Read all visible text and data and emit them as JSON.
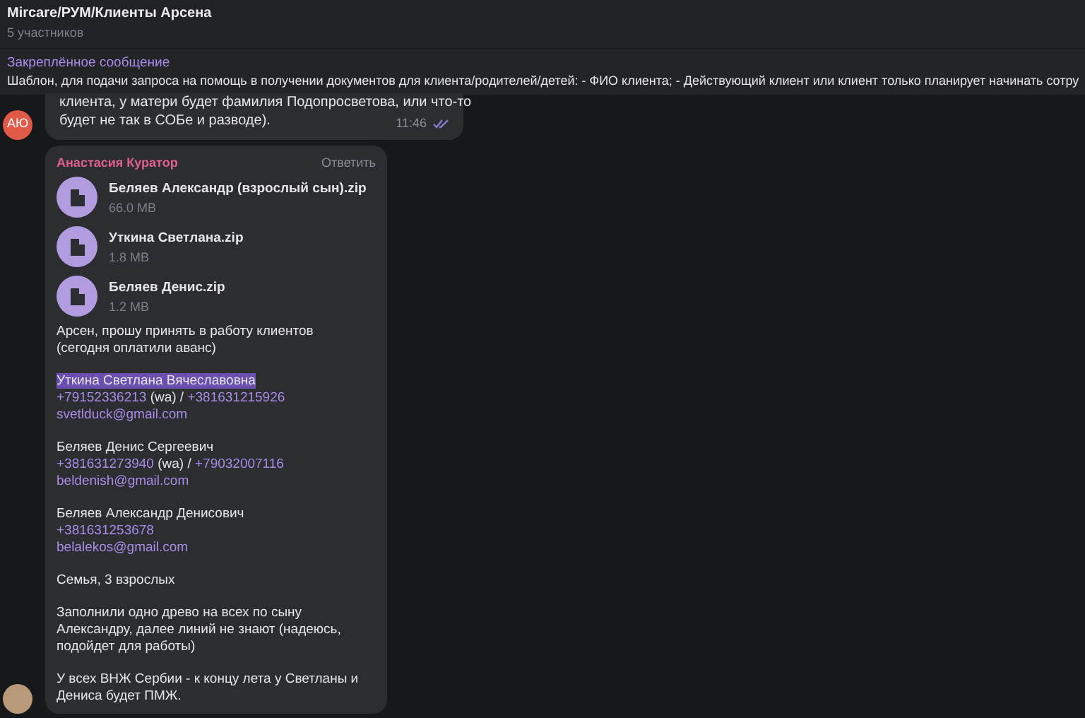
{
  "header": {
    "title": "Mircare/РУМ/Клиенты Арсена",
    "subtitle": "5 участников"
  },
  "pinned": {
    "label": "Закреплённое сообщение",
    "text": "Шаблон, для подачи запроса на помощь в получении документов для клиента/родителей/детей: - ФИО клиента; - Действующий клиент или клиент только планирует начинать сотру"
  },
  "messages": [
    {
      "kind": "text",
      "avatar": {
        "kind": "initials",
        "initials": "АЮ",
        "color": "#e05a47"
      },
      "lines": [
        "клиента, у матери будет фамилия Подопросветова, или что-то",
        "будет не так в СОБе и разводе)."
      ],
      "time": "11:46",
      "read": true
    },
    {
      "kind": "files",
      "avatar": {
        "kind": "photo"
      },
      "sender": "Анастасия Куратор",
      "reply": "Ответить",
      "files": [
        {
          "name": "Беляев Александр (взрослый сын).zip",
          "size": "66.0 MB"
        },
        {
          "name": "Уткина Светлана.zip",
          "size": "1.8 MB"
        },
        {
          "name": "Беляев Денис.zip",
          "size": "1.2 MB"
        }
      ],
      "intro": [
        "Арсен, прошу принять в работу клиентов",
        "(сегодня оплатили аванс)"
      ],
      "contacts": [
        {
          "name": "Уткина Светлана Вячеславовна",
          "selected": true,
          "phones": [
            {
              "number": "+79152336213",
              "note": "(wa) /"
            },
            {
              "number": "+381631215926"
            }
          ],
          "email": "svetlduck@gmail.com"
        },
        {
          "name": "Беляев Денис Сергеевич",
          "selected": false,
          "phones": [
            {
              "number": "+381631273940",
              "note": "(wa) /"
            },
            {
              "number": "+79032007116"
            }
          ],
          "email": "beldenish@gmail.com"
        },
        {
          "name": "Беляев Александр Денисович",
          "selected": false,
          "phones": [
            {
              "number": "+381631253678"
            }
          ],
          "email": "belalekos@gmail.com"
        }
      ],
      "outro": [
        [
          "Семья, 3 взрослых"
        ],
        [
          "Заполнили одно древо на всех по сыну",
          "Александру, далее линий не знают (надеюсь,",
          "подойдет для работы)"
        ],
        [
          "У всех ВНЖ Сербии - к концу лета у Светланы и",
          "Дениса будет ПМЖ."
        ]
      ]
    }
  ]
}
